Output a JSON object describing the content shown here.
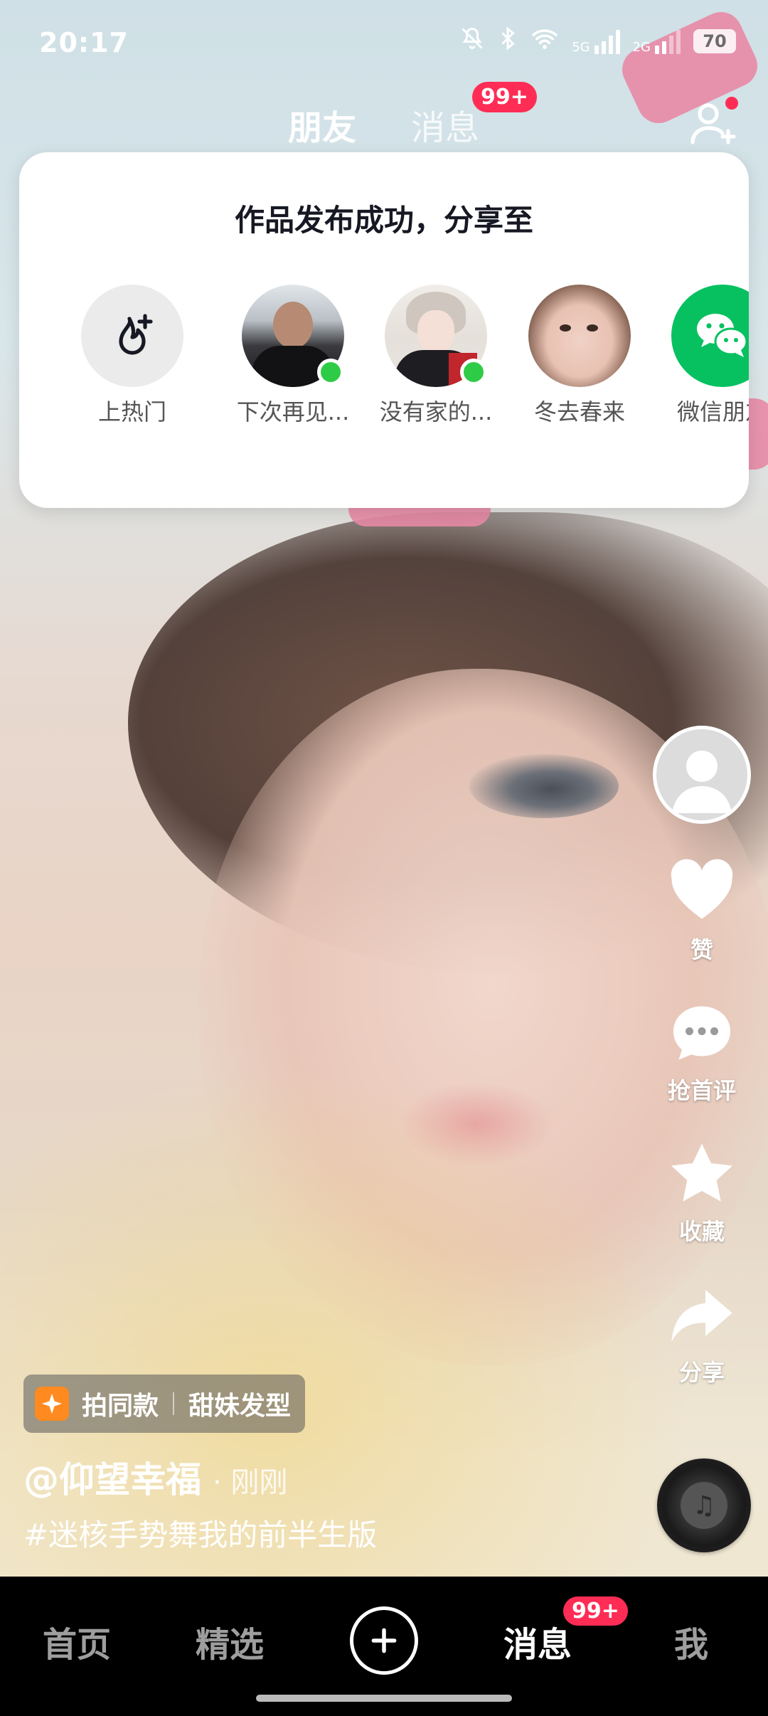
{
  "status_bar": {
    "time": "20:17",
    "signal1_label": "5G",
    "signal2_label": "2G",
    "battery": "70"
  },
  "top_tabs": {
    "friends": "朋友",
    "messages": "消息",
    "messages_badge": "99+"
  },
  "share_card": {
    "title": "作品发布成功，分享至",
    "items": [
      {
        "label": "上热门",
        "icon": "trending-flame-icon"
      },
      {
        "label": "下次再见...",
        "icon": "avatar-man"
      },
      {
        "label": "没有家的...",
        "icon": "avatar-anime"
      },
      {
        "label": "冬去春来",
        "icon": "avatar-baby"
      },
      {
        "label": "微信朋友",
        "icon": "wechat-icon"
      }
    ]
  },
  "right_rail": {
    "like_label": "赞",
    "comment_label": "抢首评",
    "favorite_label": "收藏",
    "share_label": "分享"
  },
  "video_info": {
    "template_action": "拍同款",
    "template_name": "甜妹发型",
    "author": "@仰望幸福",
    "time": "· 刚刚",
    "caption": "#迷核手势舞我的前半生版"
  },
  "bottom_nav": {
    "home": "首页",
    "featured": "精选",
    "messages": "消息",
    "messages_badge": "99+",
    "me": "我"
  },
  "colors": {
    "badge": "#ff2d55",
    "online": "#2ecc46",
    "wechat": "#07c160",
    "chip_icon": "#ff8a1f"
  }
}
